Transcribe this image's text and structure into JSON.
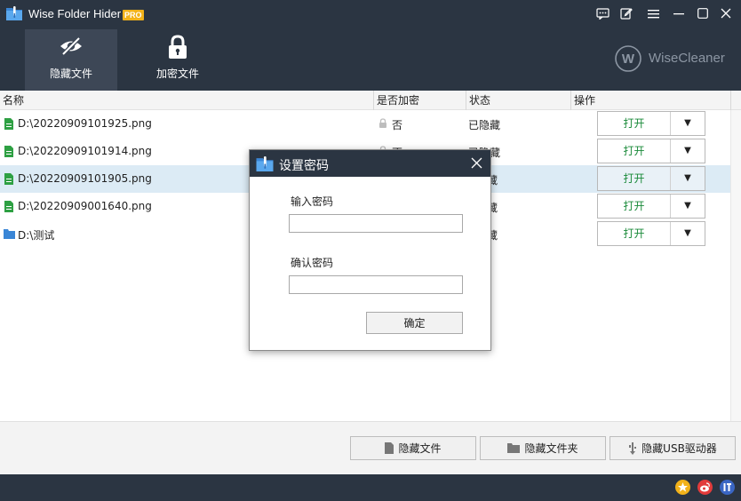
{
  "app": {
    "title": "Wise Folder Hider",
    "badge": "PRO"
  },
  "brand": {
    "name": "WiseCleaner",
    "logo_icon": "wisecleaner-w-icon"
  },
  "nav": [
    {
      "label": "隐藏文件",
      "icon": "eye-slash-icon",
      "active": true
    },
    {
      "label": "加密文件",
      "icon": "lock-icon",
      "active": false
    }
  ],
  "window_controls": [
    "feedback-icon",
    "edit-icon",
    "menu-icon",
    "maximize-icon",
    "close-icon"
  ],
  "columns": {
    "name": "名称",
    "encrypted": "是否加密",
    "status": "状态",
    "actions": "操作"
  },
  "rows": [
    {
      "name": "D:\\20220909101925.png",
      "type": "file",
      "encrypted": "否",
      "status": "已隐藏",
      "open": "打开",
      "selected": false
    },
    {
      "name": "D:\\20220909101914.png",
      "type": "file",
      "encrypted": "否",
      "status": "已隐藏",
      "open": "打开",
      "selected": false
    },
    {
      "name": "D:\\20220909101905.png",
      "type": "file",
      "encrypted": "",
      "status": "藏",
      "open": "打开",
      "selected": true
    },
    {
      "name": "D:\\20220909001640.png",
      "type": "file",
      "encrypted": "",
      "status": "藏",
      "open": "打开",
      "selected": false
    },
    {
      "name": "D:\\测试",
      "type": "folder",
      "encrypted": "",
      "status": "藏",
      "open": "打开",
      "selected": false
    }
  ],
  "bottom_buttons": [
    {
      "label": "隐藏文件",
      "icon": "file-icon"
    },
    {
      "label": "隐藏文件夹",
      "icon": "folder-icon"
    },
    {
      "label": "隐藏USB驱动器",
      "icon": "usb-icon"
    }
  ],
  "status_icons": [
    "star-icon",
    "weibo-icon",
    "tieba-icon"
  ],
  "dialog": {
    "title": "设置密码",
    "password_label": "输入密码",
    "password_value": "",
    "confirm_label": "确认密码",
    "confirm_value": "",
    "ok_label": "确定"
  },
  "colors": {
    "dark": "#2b3542",
    "active_tab": "#3d4756",
    "selected_row": "#dcebf5",
    "open_green": "#1a8a3a",
    "badge": "#f2b21a"
  }
}
